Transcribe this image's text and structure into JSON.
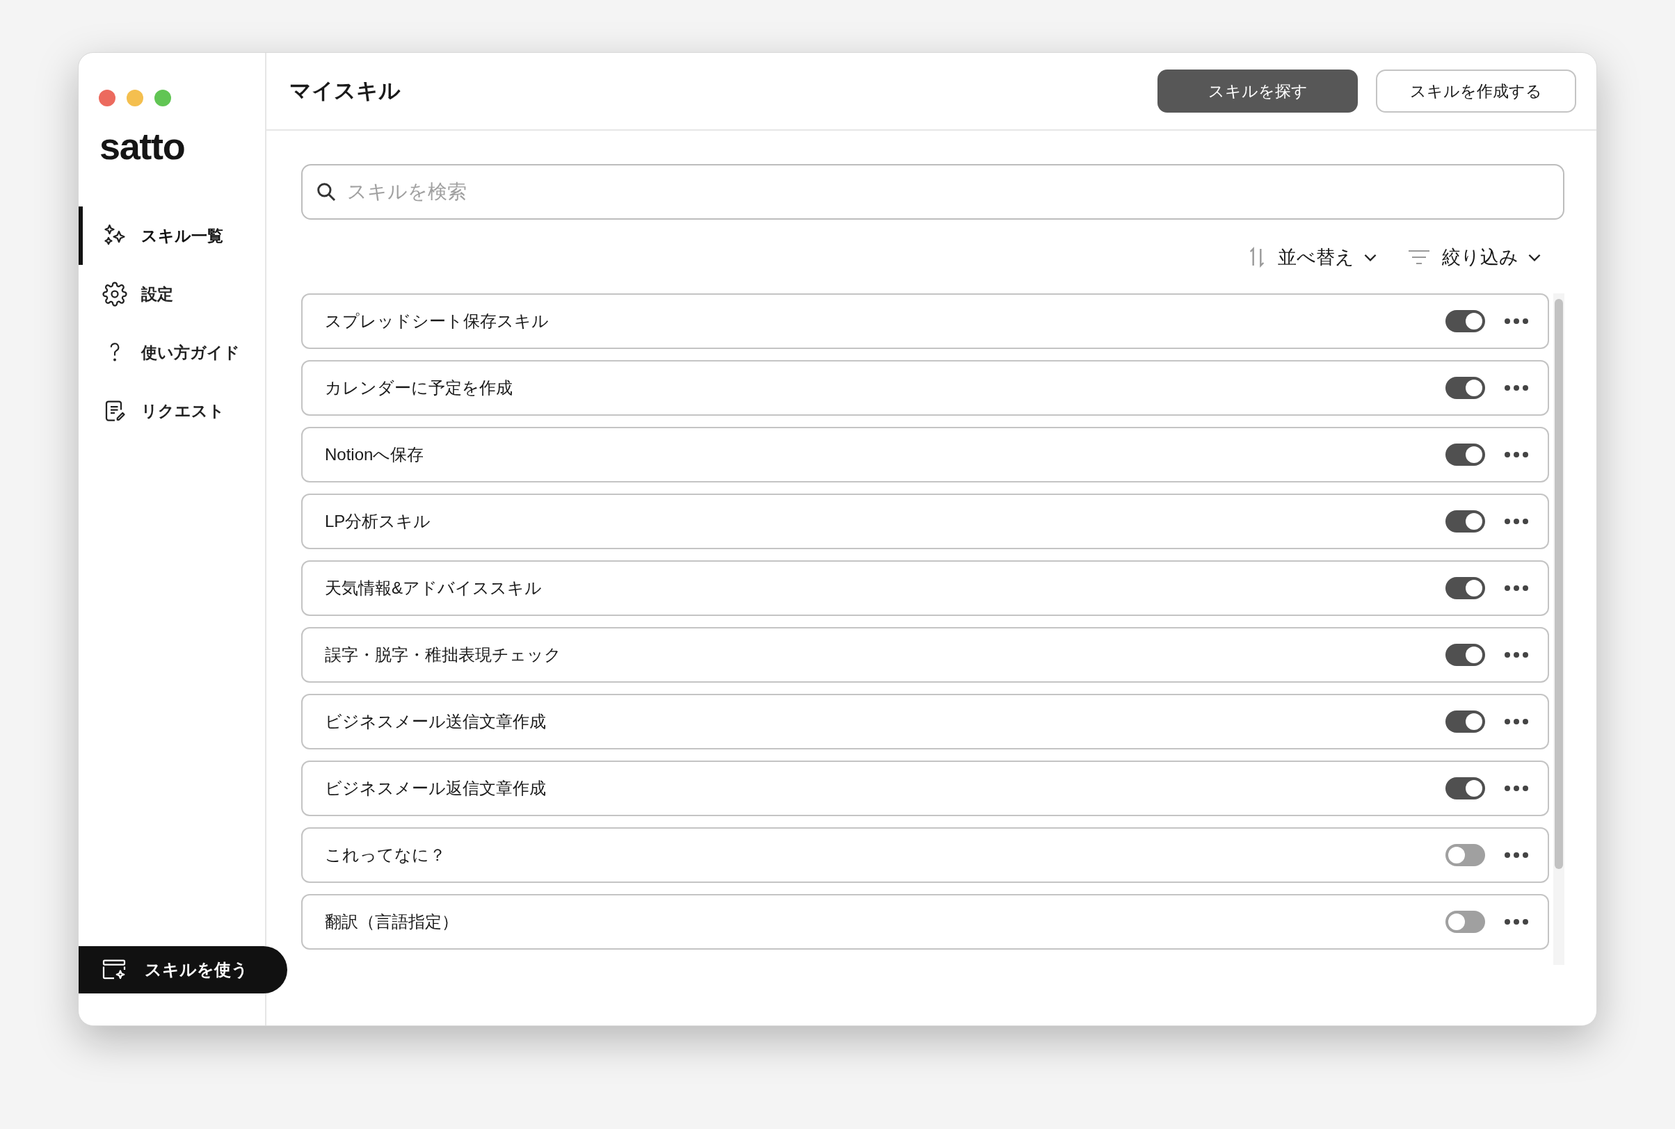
{
  "logo": "satto",
  "sidebar": {
    "items": [
      {
        "kind": "sparkles",
        "label": "スキル一覧",
        "selected": true
      },
      {
        "kind": "gear",
        "label": "設定",
        "selected": false
      },
      {
        "kind": "question",
        "label": "使い方ガイド",
        "selected": false
      },
      {
        "kind": "document",
        "label": "リクエスト",
        "selected": false
      }
    ],
    "bottom_button": "スキルを使う"
  },
  "header": {
    "title": "マイスキル",
    "buttons": [
      {
        "label": "スキルを探す",
        "kind": "primary"
      },
      {
        "label": "スキルを作成する",
        "kind": "secondary"
      }
    ]
  },
  "search": {
    "placeholder": "スキルを検索"
  },
  "sort": {
    "label": "並べ替え"
  },
  "filter": {
    "label": "絞り込み"
  },
  "skills": [
    {
      "name": "スプレッドシート保存スキル",
      "on": true
    },
    {
      "name": "カレンダーに予定を作成",
      "on": true
    },
    {
      "name": "Notionへ保存",
      "on": true
    },
    {
      "name": "LP分析スキル",
      "on": true
    },
    {
      "name": "天気情報&アドバイススキル",
      "on": true
    },
    {
      "name": "誤字・脱字・稚拙表現チェック",
      "on": true
    },
    {
      "name": "ビジネスメール送信文章作成",
      "on": true
    },
    {
      "name": "ビジネスメール返信文章作成",
      "on": true
    },
    {
      "name": "これってなに？",
      "on": false
    },
    {
      "name": "翻訳（言語指定）",
      "on": false
    }
  ]
}
